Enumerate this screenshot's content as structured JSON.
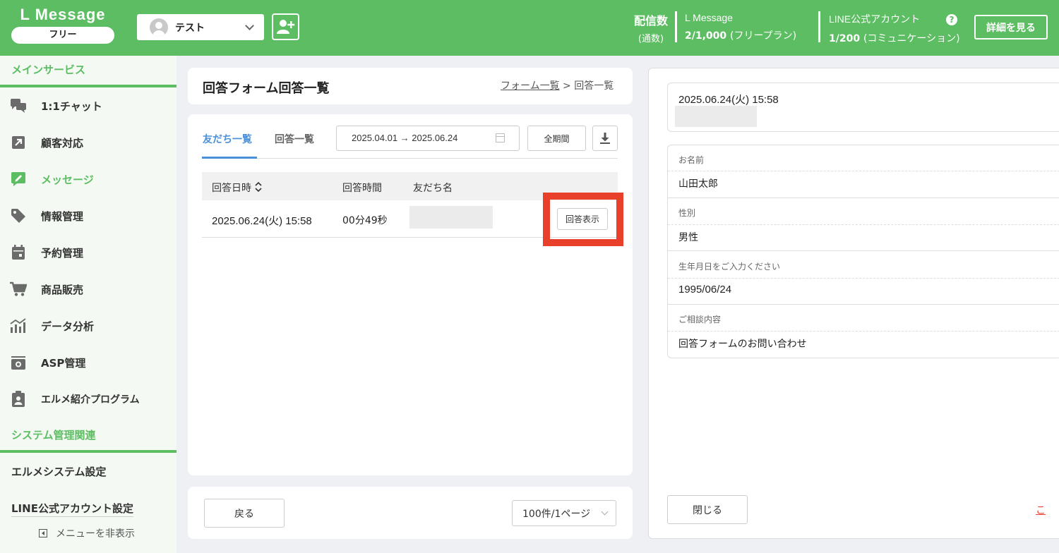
{
  "header": {
    "logo": "L Message",
    "plan": "フリー",
    "account_name": "テスト",
    "delivery_label": "配信数",
    "delivery_sub": "(通数)",
    "lmessage_label": "L Message",
    "lmessage_count": "2/1,000",
    "lmessage_plan": "(フリープラン)",
    "line_label": "LINE公式アカウント",
    "line_count": "1/200",
    "line_plan": "(コミュニケーション)",
    "help": "?",
    "details_button": "詳細を見る"
  },
  "sidebar": {
    "section_main": "メインサービス",
    "items": [
      {
        "label": "1:1チャット",
        "icon": "chat-icon"
      },
      {
        "label": "顧客対応",
        "icon": "arrow-up-right-icon"
      },
      {
        "label": "メッセージ",
        "icon": "message-edit-icon"
      },
      {
        "label": "情報管理",
        "icon": "tag-icon"
      },
      {
        "label": "予約管理",
        "icon": "calendar-icon"
      },
      {
        "label": "商品販売",
        "icon": "cart-icon"
      },
      {
        "label": "データ分析",
        "icon": "analytics-icon"
      },
      {
        "label": "ASP管理",
        "icon": "asp-icon"
      },
      {
        "label": "エルメ紹介プログラム",
        "icon": "badge-icon"
      }
    ],
    "section_system": "システム管理関連",
    "system_settings": "エルメシステム設定",
    "line_settings": "LINE公式アカウント設定",
    "hide_menu": "メニューを非表示"
  },
  "main": {
    "title": "回答フォーム回答一覧",
    "breadcrumb_link": "フォーム一覧",
    "breadcrumb_sep": ">",
    "breadcrumb_current": "回答一覧",
    "tabs": [
      {
        "label": "友だち一覧",
        "active": true
      },
      {
        "label": "回答一覧",
        "active": false
      }
    ],
    "date_range": "2025.04.01 → 2025.06.24",
    "all_period": "全期間",
    "table": {
      "headers": [
        "回答日時",
        "回答時間",
        "友だち名"
      ],
      "rows": [
        {
          "date": "2025.06.24(火) 15:58",
          "duration": "00分49秒",
          "action": "回答表示"
        }
      ]
    },
    "back_button": "戻る",
    "per_page": "100件/1ページ"
  },
  "detail": {
    "date": "2025.06.24(火) 15:58",
    "fields": [
      {
        "label": "お名前",
        "value": "山田太郎"
      },
      {
        "label": "性別",
        "value": "男性"
      },
      {
        "label": "生年月日をご入力ください",
        "value": "1995/06/24"
      },
      {
        "label": "ご相談内容",
        "value": "回答フォームのお問い合わせ"
      }
    ],
    "close_button": "閉じる",
    "edge_link": "こ"
  },
  "colors": {
    "brand_green": "#5cbd62",
    "tab_blue": "#4a90d9",
    "highlight_red": "#e8402a"
  }
}
